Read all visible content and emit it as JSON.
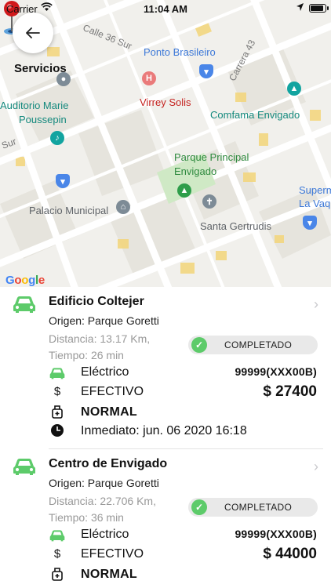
{
  "status_bar": {
    "carrier": "Carrier",
    "time": "11:04 AM",
    "battery_level": 0.95
  },
  "header": {
    "title": "Servicios"
  },
  "map": {
    "labels": {
      "calle_36_sur": "Calle 36 Sur",
      "ponto_brasileiro": "Ponto Brasileiro",
      "carrera_43": "Carrera 43",
      "auditorio": "Auditorio Marie",
      "auditorio2": "Poussepin",
      "virrey_solis": "Virrey Solis",
      "comfama": "Comfama Envigado",
      "sur": "Sur",
      "parque": "Parque Principal",
      "parque2": "Envigado",
      "palacio": "Palacio Municipal",
      "santa": "Santa Gertrudis",
      "superm": "Superm",
      "la_vaq": "La Vaq"
    },
    "attribution": [
      "G",
      "o",
      "o",
      "g",
      "l",
      "e"
    ]
  },
  "services": [
    {
      "destination": "Edificio Coltejer",
      "origin": "Origen: Parque Goretti",
      "distance": "Distancia: 13.17 Km,",
      "time": "Tiempo: 26 min",
      "status": "COMPLETADO",
      "vehicle": "Eléctrico",
      "plate": "99999(XXX00B)",
      "payment_symbol": "$",
      "payment": "EFECTIVO",
      "price": "$ 27400",
      "service_type": "NORMAL",
      "when": "Inmediato: jun. 06 2020 16:18"
    },
    {
      "destination": "Centro de Envigado",
      "origin": "Origen: Parque Goretti",
      "distance": "Distancia: 22.706 Km,",
      "time": "Tiempo: 36 min",
      "status": "COMPLETADO",
      "vehicle": "Eléctrico",
      "plate": "99999(XXX00B)",
      "payment_symbol": "$",
      "payment": "EFECTIVO",
      "price": "$ 44000",
      "service_type": "NORMAL",
      "when": ""
    }
  ],
  "colors": {
    "accent_green": "#5dcb6a",
    "badge_bg": "#e9e9e9",
    "muted_text": "#999999"
  },
  "icons": {
    "back": "arrow-left-icon",
    "car": "car-icon",
    "chevron": "chevron-right-icon",
    "check": "check-icon",
    "cash": "dollar-icon",
    "service_type": "luggage-icon",
    "clock": "clock-icon"
  }
}
